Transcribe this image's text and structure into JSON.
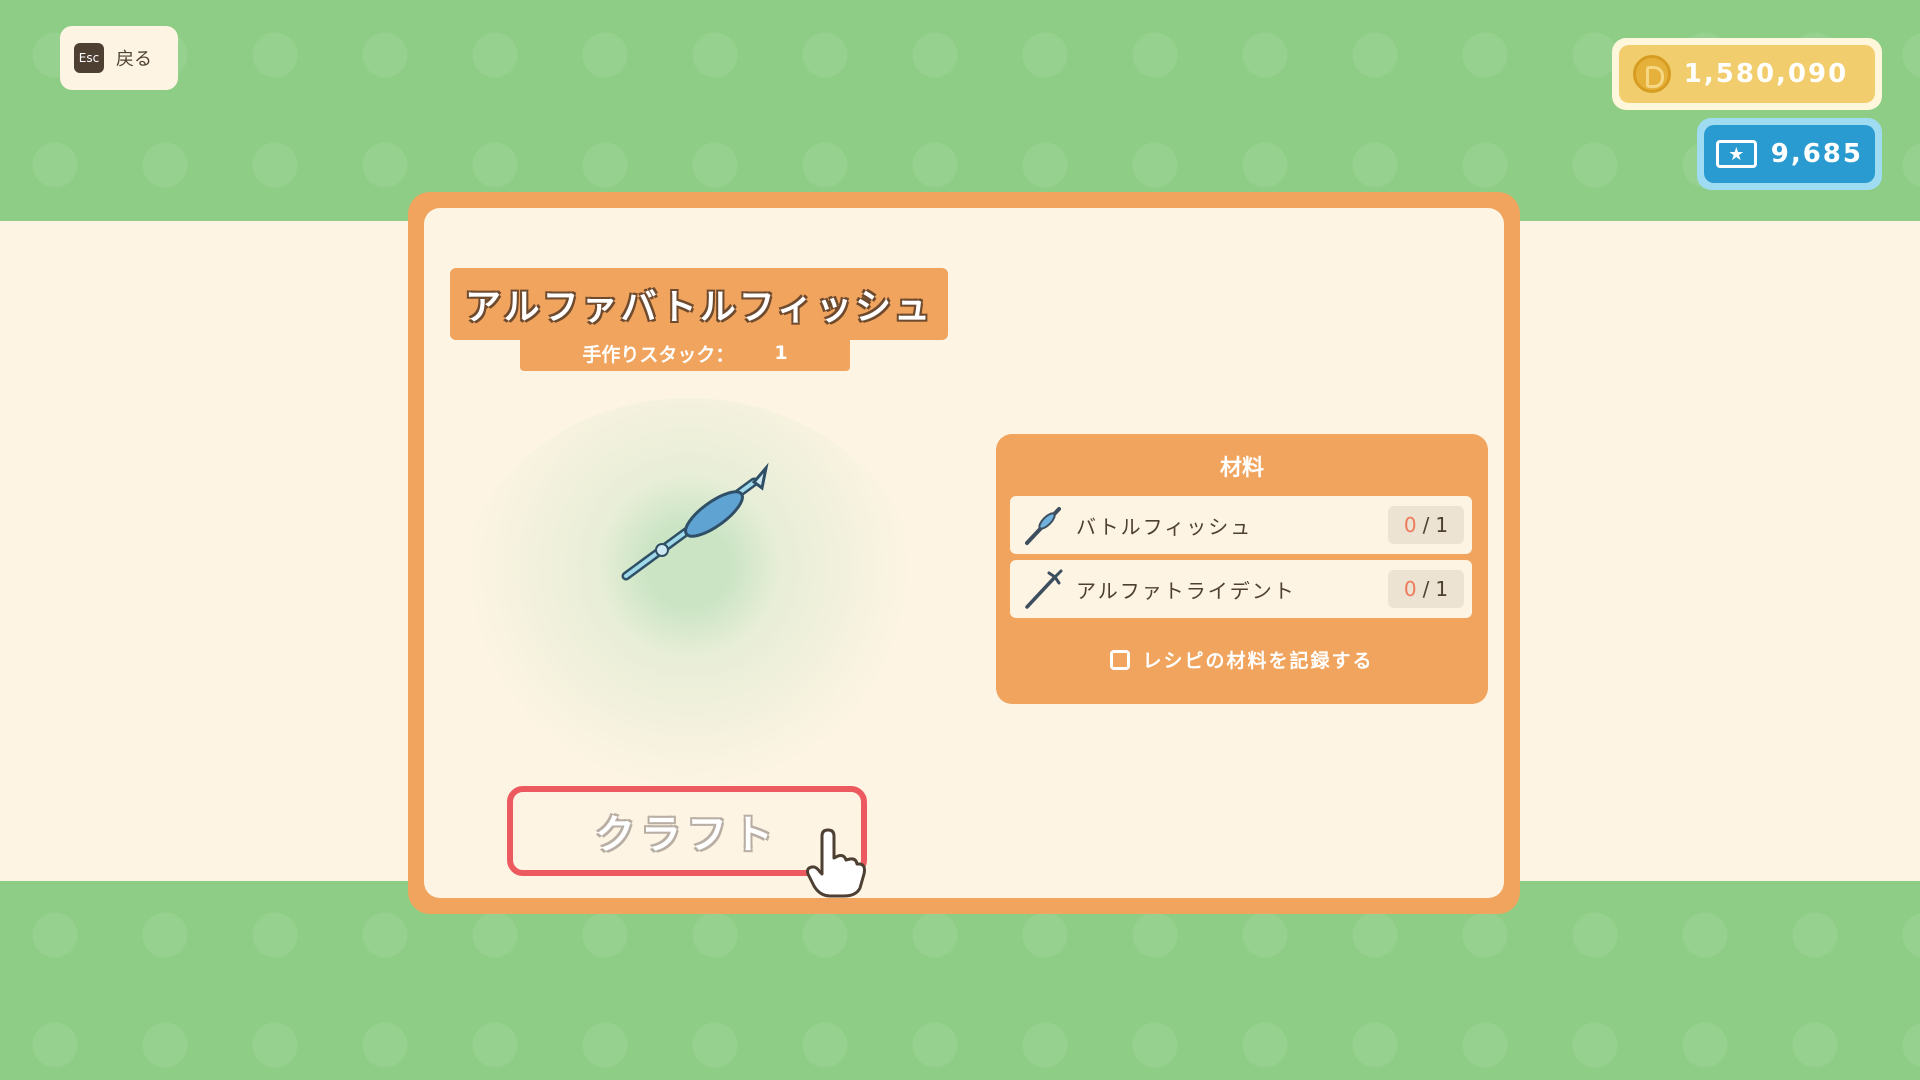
{
  "back": {
    "key": "Esc",
    "label": "戻る"
  },
  "currency": {
    "coins": "1,580,090",
    "coin_icon": "coin-icon",
    "tickets": "9,685",
    "ticket_icon": "ticket-icon"
  },
  "item": {
    "name": "アルファバトルフィッシュ",
    "stack_label": "手作りスタック：",
    "stack_value": "1",
    "icon": "trident-spear-icon"
  },
  "materials": {
    "title": "材料",
    "items": [
      {
        "name": "バトルフィッシュ",
        "have": "0",
        "slash": "/",
        "need": "1",
        "icon": "fish-spear-icon"
      },
      {
        "name": "アルファトライデント",
        "have": "0",
        "slash": "/",
        "need": "1",
        "icon": "trident-icon"
      }
    ],
    "record_label": "レシピの材料を記録する",
    "record_checked": false
  },
  "craft": {
    "label": "クラフト",
    "enabled": false
  },
  "colors": {
    "background_green": "#8ecd85",
    "panel_orange": "#f0a45e",
    "cream": "#fdf4e3",
    "craft_border": "#ec5a5f",
    "coin_yellow": "#f1cd6d",
    "ticket_blue": "#2a9bd0"
  }
}
